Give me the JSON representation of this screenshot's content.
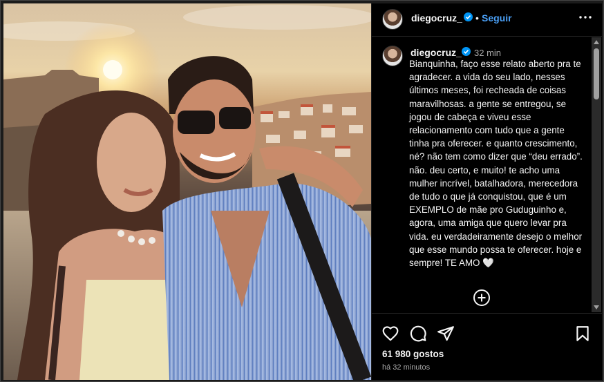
{
  "post": {
    "username": "diegocruz_",
    "follow_separator": "•",
    "follow_label": "Seguir",
    "comment_time": "32 min",
    "caption": "Bianquinha, faço esse relato aberto pra te agradecer. a vida do seu lado, nesses últimos meses, foi recheada de coisas maravilhosas. a gente se entregou, se jogou de cabeça e viveu esse relacionamento com tudo que a gente tinha pra oferecer. e quanto crescimento, né? não tem como dizer que “deu errado”. não. deu certo, e muito! te acho uma mulher incrível, batalhadora, merecedora de tudo o que já conquistou, que é um EXEMPLO de mãe pro Guduguinho e, agora, uma amiga que quero levar pra vida. eu verdadeiramente desejo o melhor que esse mundo possa te oferecer. hoje e sempre! TE AMO 🤍",
    "likes": "61 980 gostos",
    "posted_ago": "há 32 minutos"
  },
  "icons": {
    "verified": "verified-badge-icon",
    "more": "more-options-icon",
    "add_comment": "add-comment-icon",
    "like": "heart-icon",
    "comment": "comment-icon",
    "share": "share-icon",
    "save": "bookmark-icon"
  },
  "colors": {
    "accent": "#4a9ff5",
    "verified": "#0095f6",
    "text": "#f5f5f5",
    "muted": "#a8a8a8",
    "panel": "#000000"
  }
}
